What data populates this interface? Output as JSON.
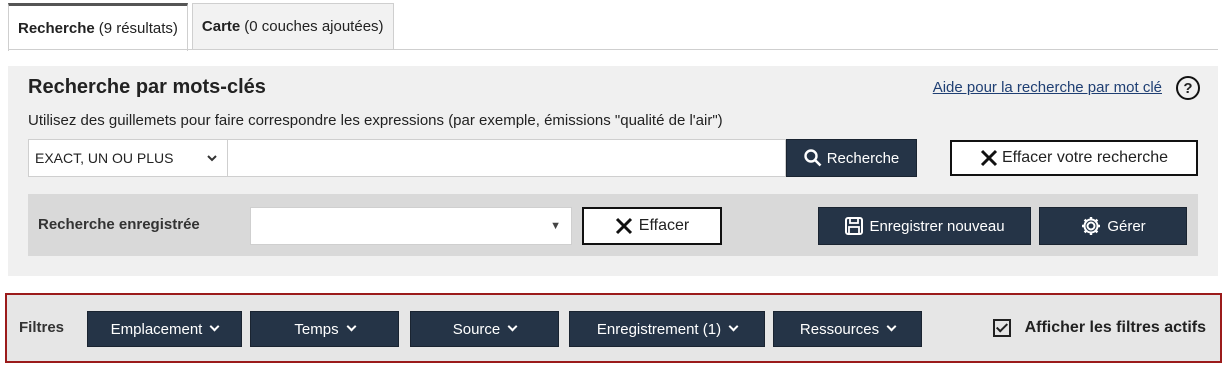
{
  "tabs": [
    {
      "title": "Recherche",
      "meta": "(9 résultats)",
      "active": true
    },
    {
      "title": "Carte",
      "meta": "(0 couches ajoutées)",
      "active": false
    }
  ],
  "search": {
    "title": "Recherche par mots-clés",
    "help_link": "Aide pour la recherche par mot clé",
    "help_icon": "question-icon",
    "hint": "Utilisez des guillemets pour faire correspondre les expressions (par exemple, émissions \"qualité de l'air\")",
    "mode_value": "EXACT, UN OU PLUS",
    "query_value": "",
    "search_button": "Recherche",
    "clear_button": "Effacer votre recherche"
  },
  "saved": {
    "label": "Recherche enregistrée",
    "selected": "",
    "clear_button": "Effacer",
    "save_new_button": "Enregistrer nouveau",
    "manage_button": "Gérer"
  },
  "filters": {
    "label": "Filtres",
    "buttons": [
      "Emplacement",
      "Temps",
      "Source",
      "Enregistrement (1)",
      "Ressources"
    ],
    "show_active_label": "Afficher les filtres actifs",
    "show_active_checked": true
  },
  "colors": {
    "dark_button": "#253447",
    "filter_border": "#9b1b1b",
    "link": "#1f3f73"
  }
}
